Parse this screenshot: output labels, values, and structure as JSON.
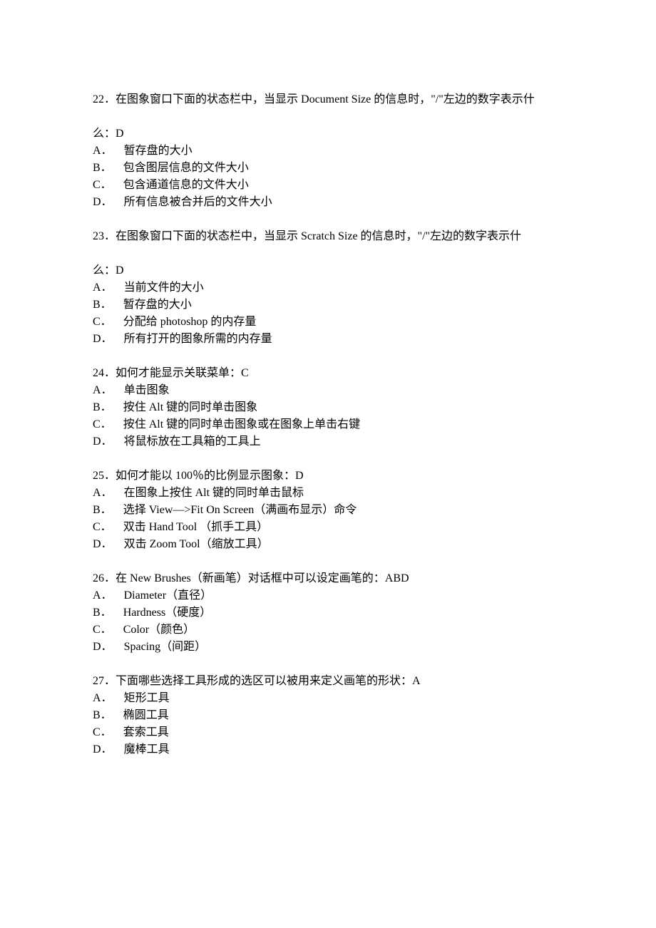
{
  "questions": [
    {
      "number": "22．",
      "stem": "在图象窗口下面的状态栏中，当显示 Document Size 的信息时，\"/\"左边的数字表示什",
      "continuation": "么：D",
      "options": [
        {
          "letter": "A．",
          "text": "暂存盘的大小"
        },
        {
          "letter": "B．",
          "text": "包含图层信息的文件大小"
        },
        {
          "letter": "C．",
          "text": "包含通道信息的文件大小"
        },
        {
          "letter": "D．",
          "text": "所有信息被合并后的文件大小"
        }
      ]
    },
    {
      "number": "23．",
      "stem": "在图象窗口下面的状态栏中，当显示 Scratch Size 的信息时，\"/\"左边的数字表示什",
      "continuation": "么：D",
      "options": [
        {
          "letter": "A．",
          "text": "当前文件的大小"
        },
        {
          "letter": "B．",
          "text": "暂存盘的大小"
        },
        {
          "letter": "C．",
          "text": "分配给 photoshop 的内存量"
        },
        {
          "letter": "D．",
          "text": "所有打开的图象所需的内存量"
        }
      ]
    },
    {
      "number": "24．",
      "stem": "如何才能显示关联菜单：C",
      "continuation": null,
      "options": [
        {
          "letter": "A．",
          "text": "单击图象"
        },
        {
          "letter": "B．",
          "text": "按住 Alt 键的同时单击图象"
        },
        {
          "letter": "C．",
          "text": "按住 Alt 键的同时单击图象或在图象上单击右键"
        },
        {
          "letter": "D．",
          "text": "将鼠标放在工具箱的工具上"
        }
      ]
    },
    {
      "number": "25．",
      "stem": "如何才能以 100％的比例显示图象：D",
      "continuation": null,
      "options": [
        {
          "letter": "A．",
          "text": "在图象上按住 Alt 键的同时单击鼠标"
        },
        {
          "letter": "B．",
          "text": "选择 View—>Fit On Screen（满画布显示）命令"
        },
        {
          "letter": "C．",
          "text": "双击 Hand Tool （抓手工具）"
        },
        {
          "letter": "D．",
          "text": "双击 Zoom Tool（缩放工具）"
        }
      ]
    },
    {
      "number": "26．",
      "stem": "在 New Brushes（新画笔）对话框中可以设定画笔的：ABD",
      "continuation": null,
      "options": [
        {
          "letter": "A．",
          "text": "Diameter（直径）"
        },
        {
          "letter": "B．",
          "text": "Hardness（硬度）"
        },
        {
          "letter": "C．",
          "text": "Color（颜色）"
        },
        {
          "letter": "D．",
          "text": "Spacing（间距）"
        }
      ]
    },
    {
      "number": "27．",
      "stem": "下面哪些选择工具形成的选区可以被用来定义画笔的形状：A",
      "continuation": null,
      "options": [
        {
          "letter": "A．",
          "text": "矩形工具"
        },
        {
          "letter": "B．",
          "text": "椭圆工具"
        },
        {
          "letter": "C．",
          "text": "套索工具"
        },
        {
          "letter": "D．",
          "text": "魔棒工具"
        }
      ]
    }
  ]
}
